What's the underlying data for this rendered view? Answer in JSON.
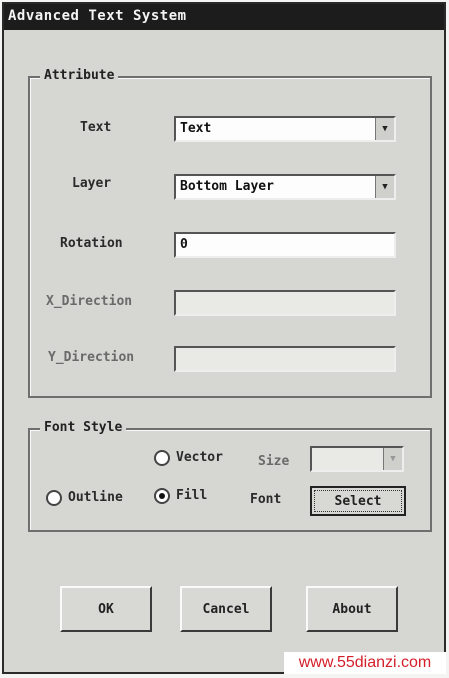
{
  "window": {
    "title": "Advanced Text System"
  },
  "attribute": {
    "group_label": "Attribute",
    "text_label": "Text",
    "text_value": "Text",
    "layer_label": "Layer",
    "layer_value": "Bottom Layer",
    "rotation_label": "Rotation",
    "rotation_value": "0",
    "x_direction_label": "X_Direction",
    "y_direction_label": "Y_Direction"
  },
  "font_style": {
    "group_label": "Font Style",
    "vector_label": "Vector",
    "size_label": "Size",
    "outline_label": "Outline",
    "fill_label": "Fill",
    "font_label": "Font",
    "select_button": "Select"
  },
  "buttons": {
    "ok": "OK",
    "cancel": "Cancel",
    "about": "About"
  },
  "watermark": "www.55dianzi.com",
  "colors": {
    "titlebar": "#1c1c1c",
    "watermark": "#d4202a"
  }
}
